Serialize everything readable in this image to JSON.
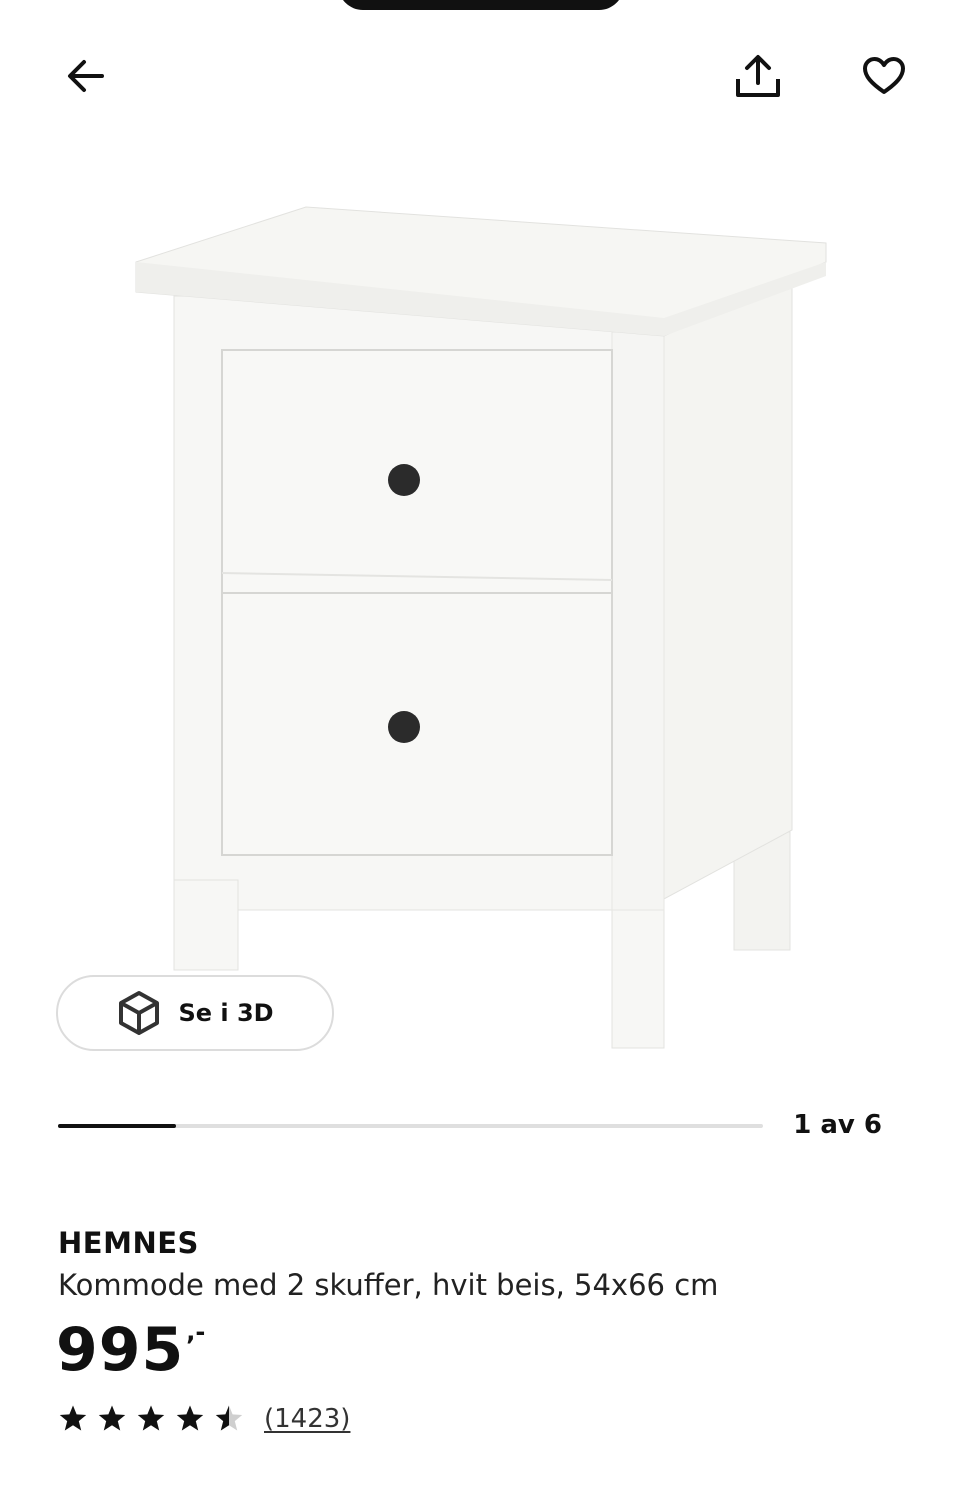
{
  "header": {
    "back_icon": "arrow-left-icon",
    "share_icon": "share-icon",
    "favorite_icon": "heart-icon"
  },
  "gallery": {
    "image": "white-nightstand-2-drawers",
    "view3d_label": "Se i 3D",
    "view3d_icon": "cube-icon",
    "counter_text": "1 av 6",
    "current": 1,
    "total": 6
  },
  "product": {
    "name": "HEMNES",
    "description": "Kommode med 2 skuffer, hvit beis, 54x66 cm",
    "price_integer": "995",
    "price_suffix": ",-",
    "rating": 4.5,
    "rating_max": 5,
    "review_count": "(1423)"
  },
  "colors": {
    "text": "#111111",
    "track": "#dfdfdf",
    "border": "#dcdcdc"
  }
}
